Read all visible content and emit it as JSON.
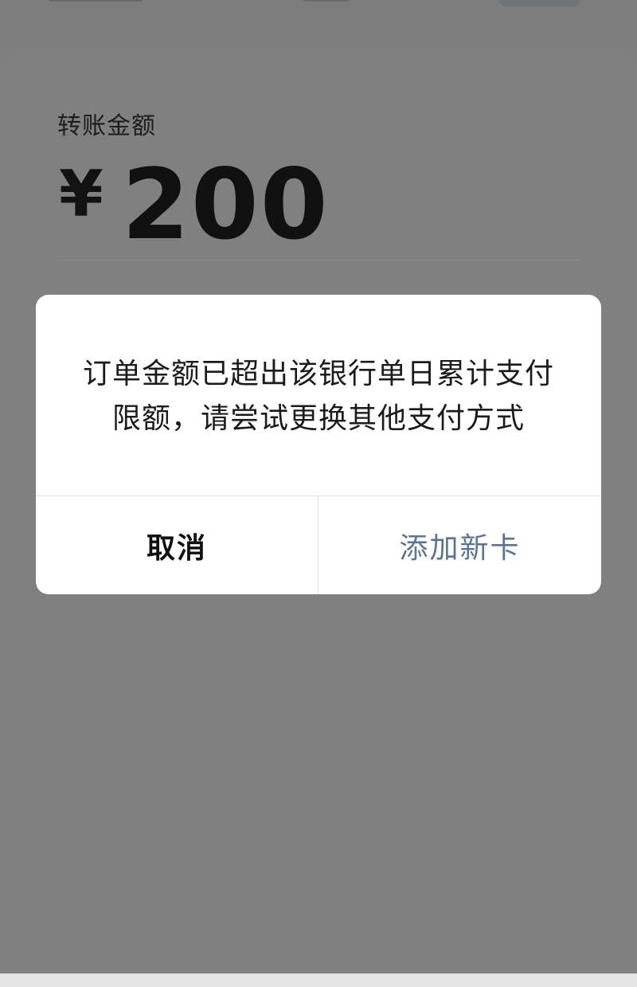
{
  "transfer": {
    "label": "转账金额",
    "currency_symbol": "¥",
    "amount": "200"
  },
  "dialog": {
    "message_line1": "订单金额已超出该银行单日累计支付",
    "message_line2": "限额，请尝试更换其他支付方式",
    "cancel_label": "取消",
    "add_card_label": "添加新卡"
  },
  "colors": {
    "overlay": "#7f7f7f",
    "dialog_bg": "#ffffff",
    "primary_action_text": "#5b7396",
    "secondary_action_text": "#111111"
  }
}
